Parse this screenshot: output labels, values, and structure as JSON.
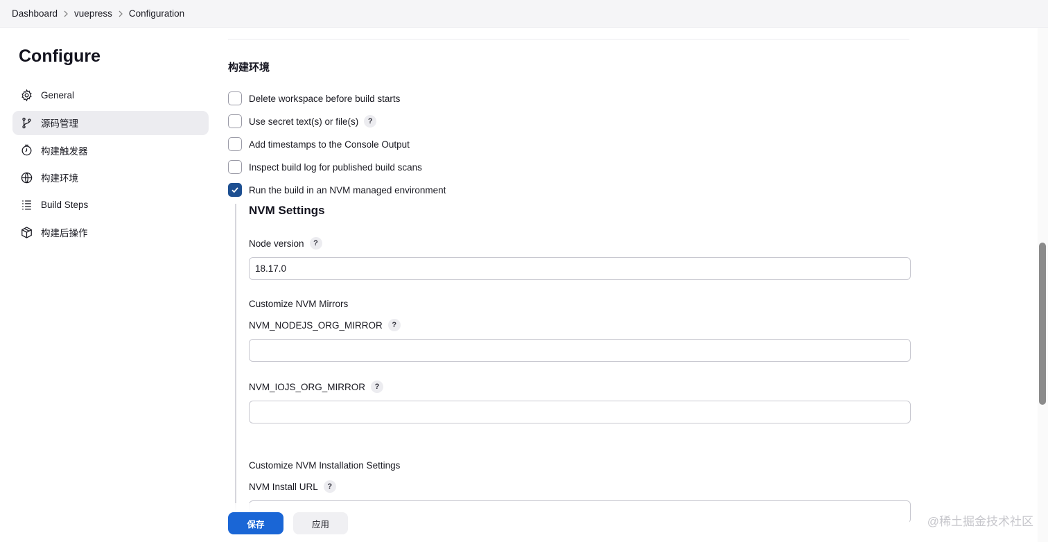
{
  "breadcrumb": {
    "items": [
      "Dashboard",
      "vuepress",
      "Configuration"
    ]
  },
  "sidebar": {
    "title": "Configure",
    "items": [
      {
        "label": "General",
        "icon": "gear-icon"
      },
      {
        "label": "源码管理",
        "icon": "branch-icon",
        "active": true
      },
      {
        "label": "构建触发器",
        "icon": "clock-icon"
      },
      {
        "label": "构建环境",
        "icon": "globe-icon"
      },
      {
        "label": "Build Steps",
        "icon": "list-icon"
      },
      {
        "label": "构建后操作",
        "icon": "package-icon"
      }
    ]
  },
  "main": {
    "section_title": "构建环境",
    "checkboxes": [
      {
        "label": "Delete workspace before build starts",
        "checked": false,
        "help": false
      },
      {
        "label": "Use secret text(s) or file(s)",
        "checked": false,
        "help": true
      },
      {
        "label": "Add timestamps to the Console Output",
        "checked": false,
        "help": false
      },
      {
        "label": "Inspect build log for published build scans",
        "checked": false,
        "help": false
      },
      {
        "label": "Run the build in an NVM managed environment",
        "checked": true,
        "help": false
      }
    ],
    "nvm": {
      "title": "NVM Settings",
      "node_version_label": "Node version",
      "node_version_value": "18.17.0",
      "mirrors_label": "Customize NVM Mirrors",
      "nodejs_mirror_label": "NVM_NODEJS_ORG_MIRROR",
      "nodejs_mirror_value": "",
      "iojs_mirror_label": "NVM_IOJS_ORG_MIRROR",
      "iojs_mirror_value": "",
      "install_settings_label": "Customize NVM Installation Settings",
      "install_url_label": "NVM Install URL"
    },
    "help_glyph": "?"
  },
  "footer": {
    "save_label": "保存",
    "apply_label": "应用",
    "watermark": "@稀土掘金技术社区"
  },
  "colors": {
    "primary": "#1a66d6",
    "checkbox_checked": "#1d4f91",
    "sidebar_active": "#ececf0"
  }
}
